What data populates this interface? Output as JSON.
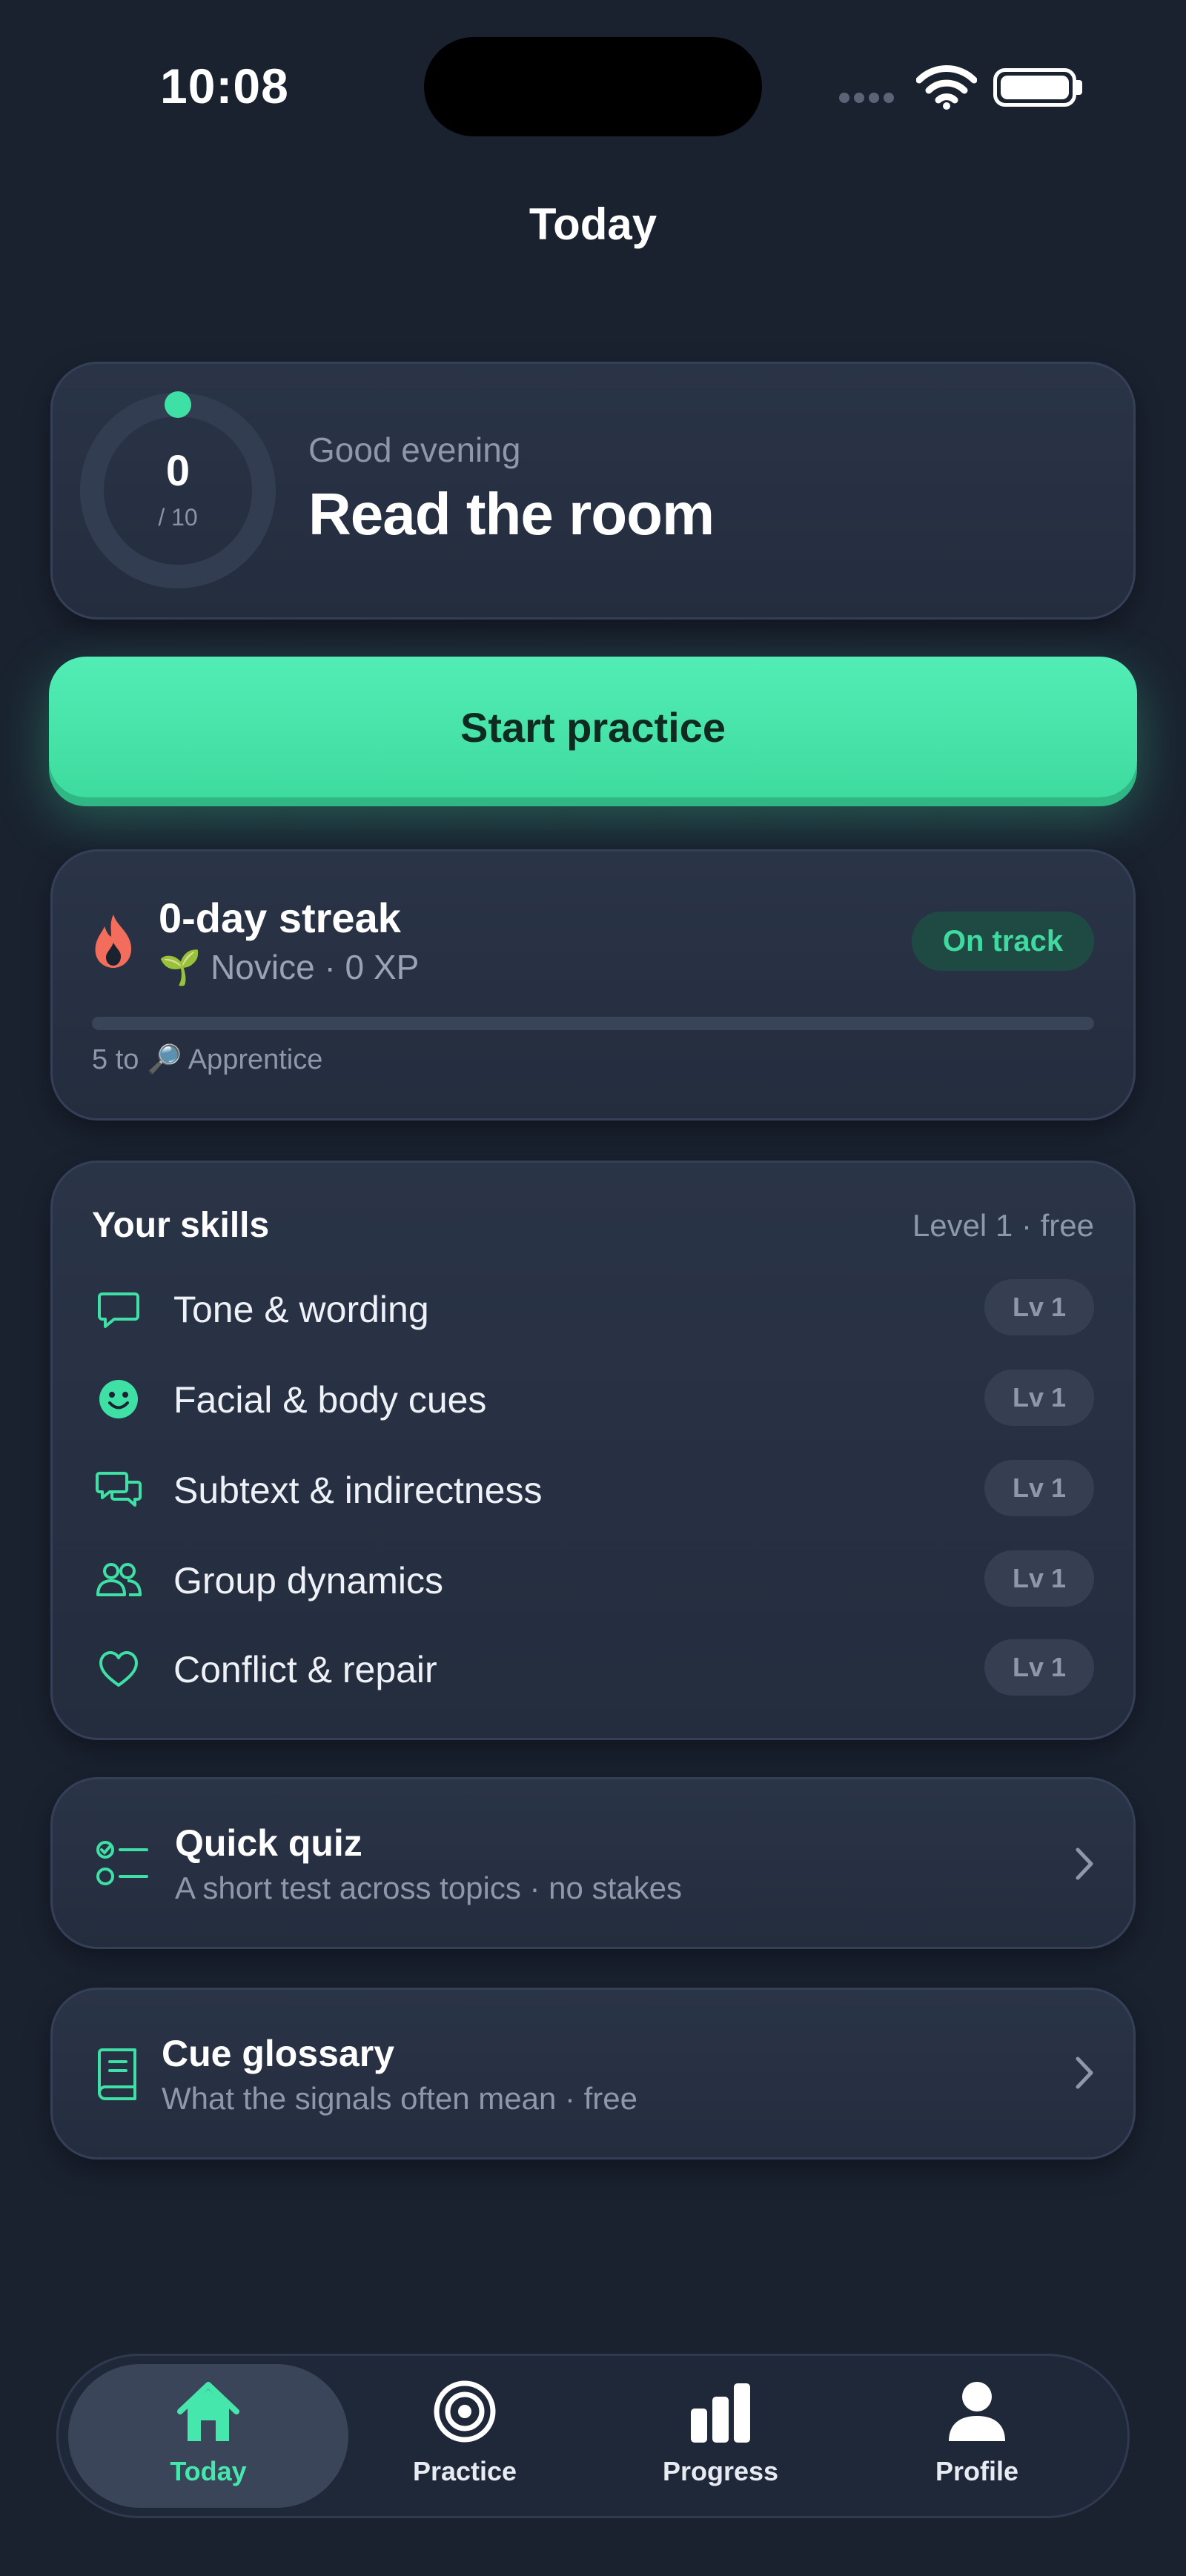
{
  "status_bar": {
    "time": "10:08"
  },
  "header": {
    "title": "Today"
  },
  "hero": {
    "ring_value": "0",
    "ring_total": "/ 10",
    "greeting": "Good evening",
    "title": "Read the room"
  },
  "start_button": {
    "label": "Start practice"
  },
  "streak": {
    "title": "0-day streak",
    "rank_icon": "🌱",
    "rank": "Novice · 0 XP",
    "badge": "On track",
    "progress": 0,
    "next_level": "5 to 🔎 Apprentice"
  },
  "skills": {
    "title": "Your skills",
    "level_info": "Level 1 · free",
    "items": [
      {
        "label": "Tone & wording",
        "level": "Lv 1",
        "icon": "speech-bubble-icon"
      },
      {
        "label": "Facial & body cues",
        "level": "Lv 1",
        "icon": "smiley-face-icon"
      },
      {
        "label": "Subtext & indirectness",
        "level": "Lv 1",
        "icon": "two-bubbles-icon"
      },
      {
        "label": "Group dynamics",
        "level": "Lv 1",
        "icon": "people-icon"
      },
      {
        "label": "Conflict & repair",
        "level": "Lv 1",
        "icon": "heart-icon"
      }
    ]
  },
  "quiz": {
    "title": "Quick quiz",
    "subtitle": "A short test across topics · no stakes"
  },
  "glossary": {
    "title": "Cue glossary",
    "subtitle": "What the signals often mean · free"
  },
  "nav": {
    "tabs": [
      {
        "label": "Today",
        "icon": "home-icon",
        "active": true
      },
      {
        "label": "Practice",
        "icon": "target-icon",
        "active": false
      },
      {
        "label": "Progress",
        "icon": "bar-chart-icon",
        "active": false
      },
      {
        "label": "Profile",
        "icon": "person-icon",
        "active": false
      }
    ]
  },
  "colors": {
    "accent": "#3fe0a5",
    "background": "#1a2230",
    "card": "#2a3447",
    "flame": "#f26d5b"
  }
}
